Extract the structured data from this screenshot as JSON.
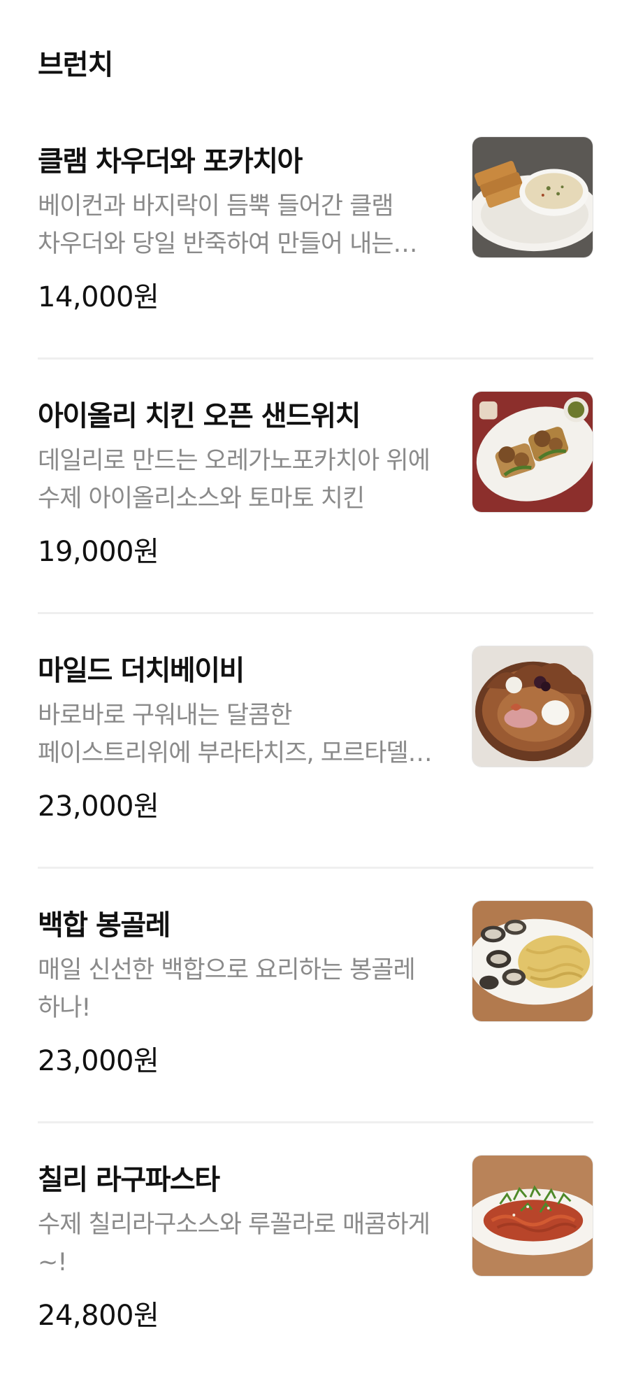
{
  "section": {
    "title": "브런치"
  },
  "items": [
    {
      "name": "클램 차우더와 포카치아",
      "description": "베이컨과 바지락이 듬뿍 들어간 클램 차우더와 당일 반죽하여 만들어 내는 포카치아",
      "price": "14,000원",
      "image_icon": "clam-chowder-photo"
    },
    {
      "name": "아이올리 치킨 오픈 샌드위치",
      "description": "데일리로 만드는 오레가노포카치아 위에 수제 아이올리소스와 토마토 치킨",
      "price": "19,000원",
      "image_icon": "chicken-sandwich-photo"
    },
    {
      "name": "마일드 더치베이비",
      "description": "바로바로 구워내는 달콤한 페이스트리위에 부라타치즈, 모르타델라, 무화과",
      "price": "23,000원",
      "image_icon": "dutch-baby-photo"
    },
    {
      "name": "백합 봉골레",
      "description": "매일 신선한 백합으로 요리하는 봉골레 하나!",
      "price": "23,000원",
      "image_icon": "vongole-photo"
    },
    {
      "name": "칠리 라구파스타",
      "description": "수제 칠리라구소스와 루꼴라로 매콤하게~!",
      "price": "24,800원",
      "image_icon": "chili-ragu-pasta-photo"
    }
  ]
}
